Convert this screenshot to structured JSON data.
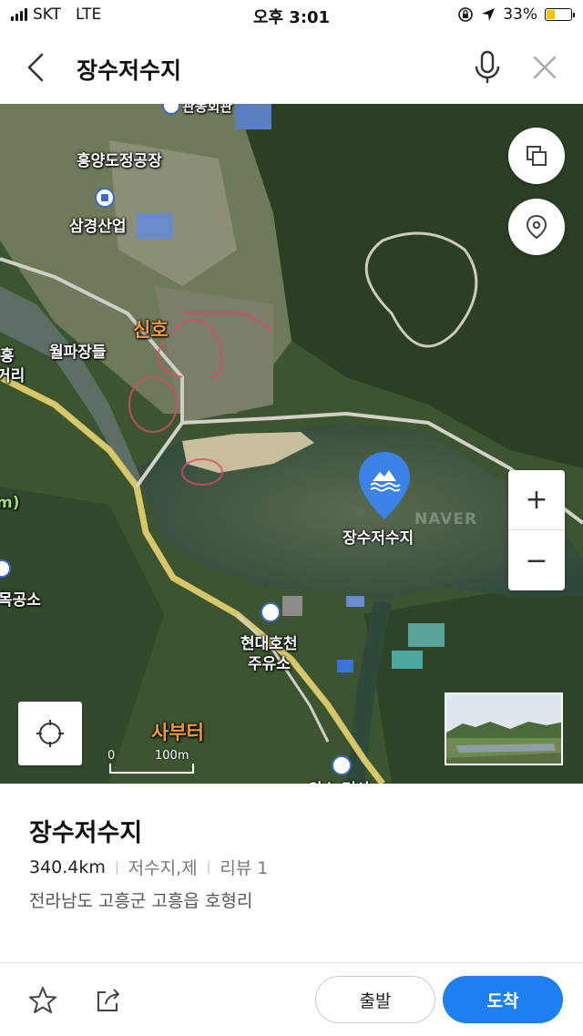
{
  "status_bar": {
    "carrier": "SKT",
    "network": "LTE",
    "time": "오후 3:01",
    "battery": "33%",
    "battery_level": 0.33
  },
  "header": {
    "title": "장수저수지",
    "icons": [
      "back-icon",
      "mic-icon",
      "close-icon"
    ]
  },
  "map": {
    "labels": {
      "factory": "흥양도정공장",
      "company": "삼경산업",
      "village": "신호",
      "plaza": "월파장들",
      "partial_top": "관동회관",
      "left_edge_1": "흥",
      "left_edge_2": "거리",
      "left_edge_3": "m)",
      "left_edge_4": "목공소",
      "gas_station_1": "현대호천",
      "gas_station_2": "주유소",
      "terminal": "사부터",
      "bottom_partial": "의소 면사"
    },
    "pin_label": "장수저수지",
    "watermark": "NAVER",
    "scale": {
      "start": "0",
      "end": "100m"
    },
    "zoom": {
      "in": "+",
      "out": "−"
    },
    "colors": {
      "pin": "#3a82e6",
      "accent": "#1e80f0"
    }
  },
  "place": {
    "name": "장수저수지",
    "distance": "340.4km",
    "category": "저수지,제",
    "review": "리뷰 1",
    "address": "전라남도 고흥군 고흥읍 호형리"
  },
  "actions": {
    "depart": "출발",
    "arrive": "도착"
  }
}
